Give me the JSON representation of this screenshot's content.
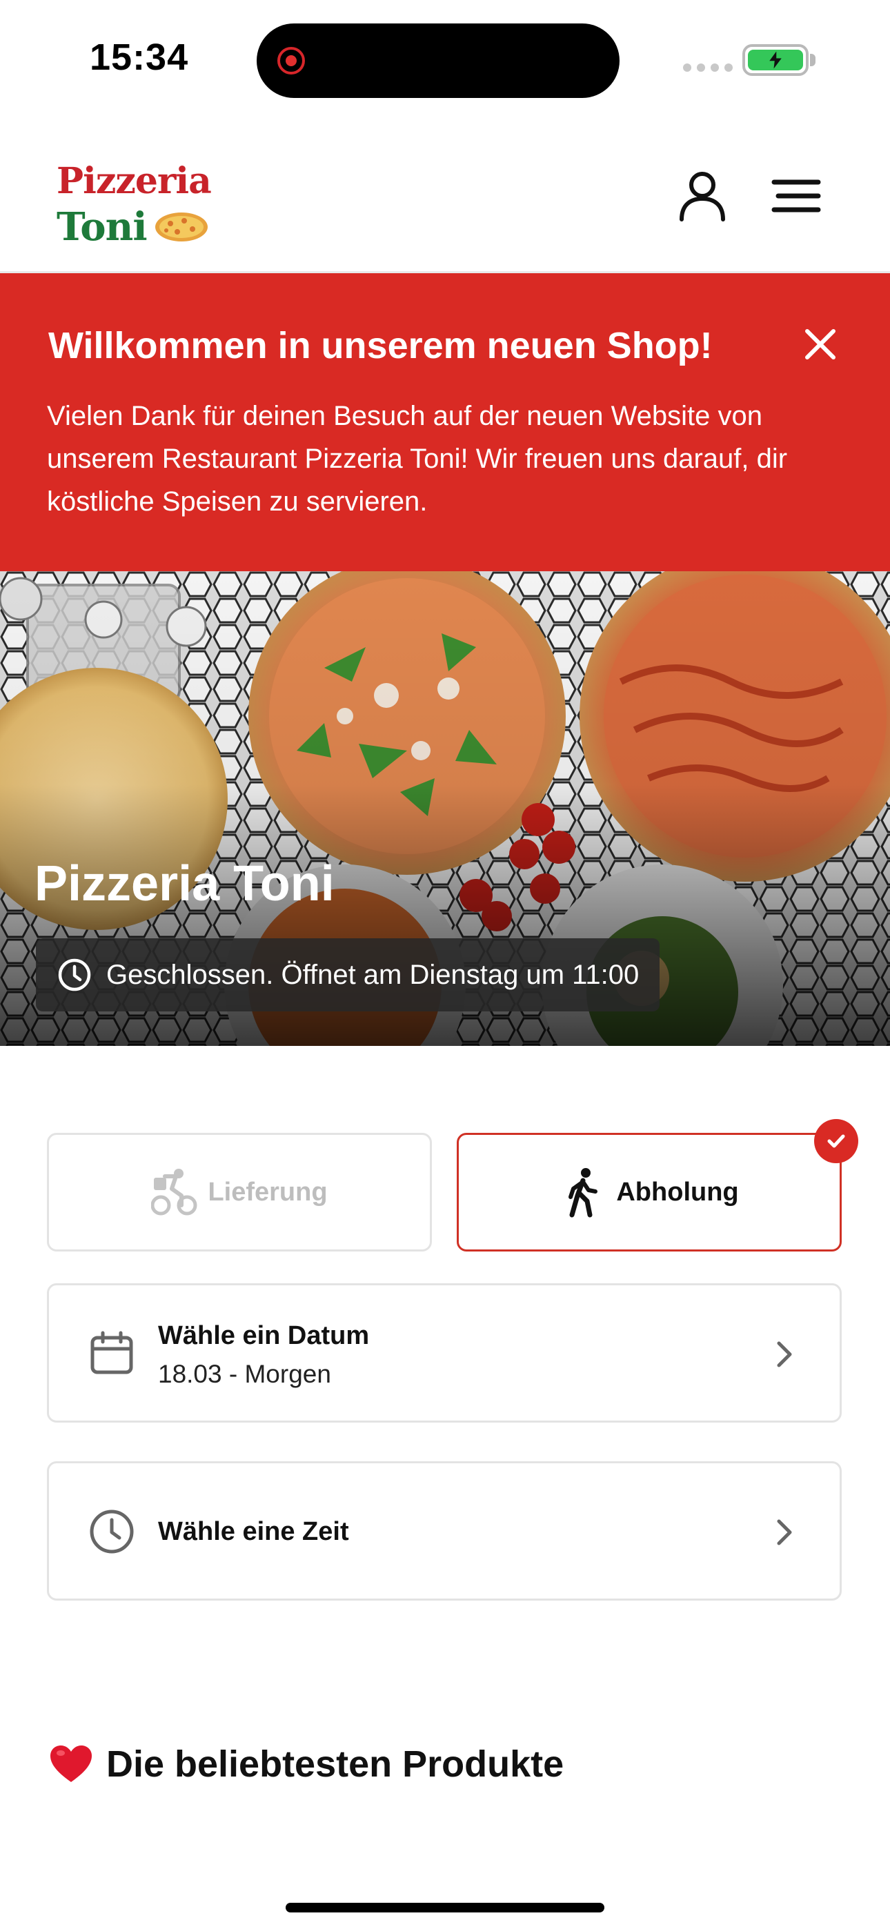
{
  "status_bar": {
    "time": "15:34"
  },
  "header": {
    "logo_line1": "Pizzeria",
    "logo_line2": "Toni",
    "icons": [
      "account-icon",
      "menu-icon"
    ]
  },
  "banner": {
    "title": "Willkommen in unserem neuen Shop!",
    "text": "Vielen Dank für deinen Besuch auf der neuen Website von unserem Restaurant Pizzeria Toni! Wir freuen uns darauf, dir köstliche Speisen zu servieren.",
    "background": "#d92a24"
  },
  "hero": {
    "title": "Pizzeria Toni",
    "status": "Geschlossen. Öffnet am Dienstag um 11:00"
  },
  "order_types": {
    "delivery_label": "Lieferung",
    "pickup_label": "Abholung",
    "selected": "Abholung"
  },
  "date_selector": {
    "title": "Wähle ein Datum",
    "value": "18.03 - Morgen"
  },
  "time_selector": {
    "title": "Wähle eine Zeit"
  },
  "section": {
    "title": "Die beliebtesten Produkte"
  },
  "colors": {
    "accent": "#d92a24",
    "logo_red": "#c8232a",
    "logo_green": "#1e7a3a"
  }
}
